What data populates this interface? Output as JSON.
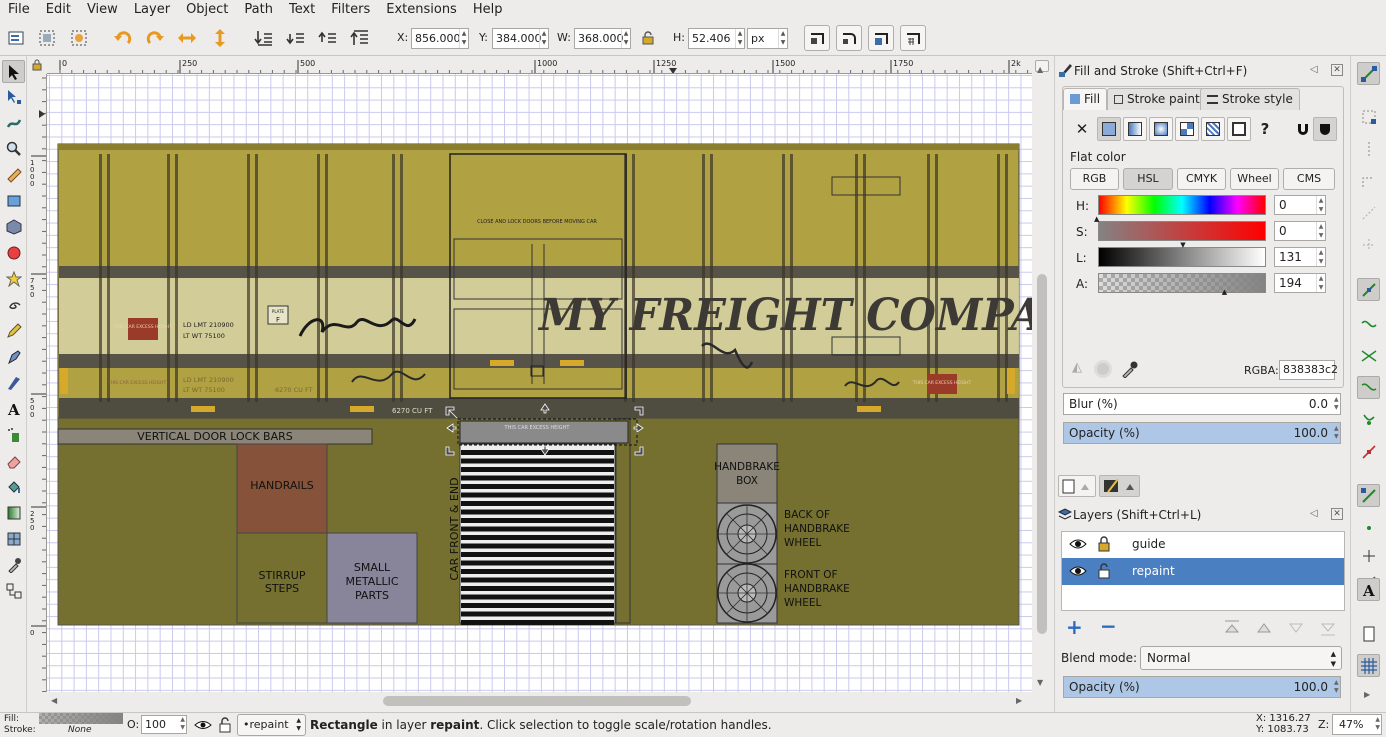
{
  "menubar": {
    "items": [
      "File",
      "Edit",
      "View",
      "Layer",
      "Object",
      "Path",
      "Text",
      "Filters",
      "Extensions",
      "Help"
    ]
  },
  "toolbar": {
    "x_label": "X:",
    "x_value": "856.000",
    "y_label": "Y:",
    "y_value": "384.000",
    "w_label": "W:",
    "w_value": "368.000",
    "h_label": "H:",
    "h_value": "52.406",
    "unit": "px"
  },
  "ruler": {
    "h_ticks": [
      "0",
      "250",
      "500",
      "1000",
      "1250",
      "1500",
      "1750",
      "2k"
    ],
    "v_ticks": [
      "1\n0\n0\n0",
      "7\n5\n0",
      "5\n0\n0",
      "2\n5\n0",
      "0"
    ]
  },
  "canvas": {
    "boxcar": {
      "company_name": "MY FREIGHT COMPANY",
      "door_notice": "CLOSE AND LOCK DOORS BEFORE MOVING CAR",
      "cubic_label": "6270 CU FT",
      "cubic_label_2": "6270 CU FT",
      "load_limit": "LD LMT   210900",
      "light_weight": "LT WT     75100",
      "load_limit_2": "LD LMT   210900",
      "light_weight_2": "LT WT     75100",
      "plate_text": "PLATE",
      "plate_letter": "F",
      "left_stencil": "THIS CAR EXCESS HEIGHT",
      "left_stencil_faded": "THIS CAR EXCESS HEIGHT",
      "right_stencil": "THIS CAR EXCESS HEIGHT",
      "selected_strip": "THIS CAR EXCESS HEIGHT"
    },
    "parts": {
      "vertical_door_lock_bars": "VERTICAL DOOR LOCK BARS",
      "handrails": "HANDRAILS",
      "stirrup_steps": "STIRRUP STEPS",
      "small_metallic_parts": "SMALL METALLIC PARTS",
      "car_front_end": "CAR FRONT & END",
      "handbrake_box": "HANDBRAKE BOX",
      "back_of_handbrake_wheel": "BACK OF HANDBRAKE WHEEL",
      "front_of_handbrake_wheel": "FRONT OF HANDBRAKE WHEEL"
    }
  },
  "fill_stroke": {
    "title": "Fill and Stroke (Shift+Ctrl+F)",
    "tabs": [
      "Fill",
      "Stroke paint",
      "Stroke style"
    ],
    "section": "Flat color",
    "modes": [
      "RGB",
      "HSL",
      "CMYK",
      "Wheel",
      "CMS"
    ],
    "selected_mode": "HSL",
    "channels": [
      {
        "label": "H:",
        "value": "0"
      },
      {
        "label": "S:",
        "value": "0"
      },
      {
        "label": "L:",
        "value": "131"
      },
      {
        "label": "A:",
        "value": "194"
      }
    ],
    "rgba_label": "RGBA:",
    "rgba_value": "838383c2",
    "blur_label": "Blur (%)",
    "blur_value": "0.0",
    "opacity_label": "Opacity (%)",
    "opacity_value": "100.0",
    "opacity_fraction": 1.0
  },
  "layers": {
    "title": "Layers (Shift+Ctrl+L)",
    "items": [
      {
        "name": "guide",
        "selected": false
      },
      {
        "name": "repaint",
        "selected": true
      }
    ],
    "blend_label": "Blend mode:",
    "blend_value": "Normal",
    "opacity_label": "Opacity (%)",
    "opacity_value": "100.0"
  },
  "statusbar": {
    "fill_label": "Fill:",
    "stroke_label": "Stroke:",
    "stroke_value": "None",
    "opacity_label": "O:",
    "opacity_value": "100",
    "layer_select": "•repaint",
    "message_bold_1": "Rectangle",
    "message_1": " in layer ",
    "message_bold_2": "repaint",
    "message_2": ". Click selection to toggle scale/rotation handles.",
    "cursor_x": "X: 1316.27",
    "cursor_y": "Y: 1083.73",
    "zoom_label": "Z:",
    "zoom_value": "47%"
  },
  "colors": {
    "boxcar_yellow": "#b2a341",
    "canvas_olive": "#757030",
    "selection_blue": "#4a7fc1",
    "hsl_hue": "#ff0000"
  }
}
